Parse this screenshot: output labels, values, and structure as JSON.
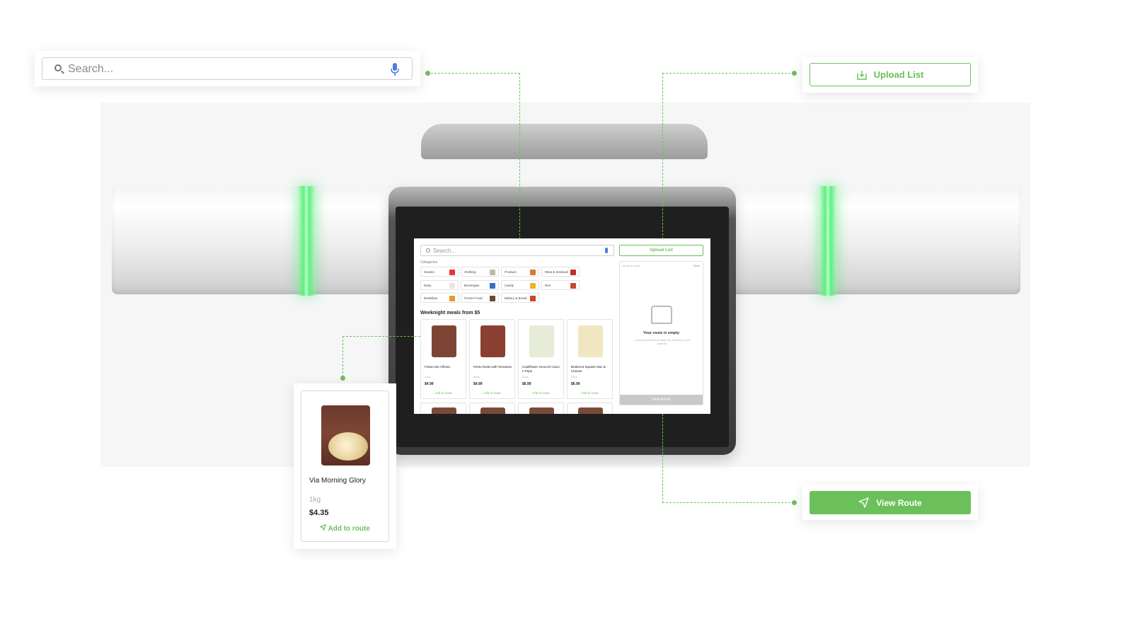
{
  "search": {
    "placeholder": "Search..."
  },
  "upload": {
    "label": "Upload List"
  },
  "view_route": {
    "label": "View Route"
  },
  "product_callout": {
    "name": "Via Morning Glory",
    "weight": "1kg",
    "price": "$4.35",
    "add_label": "Add to route"
  },
  "screen": {
    "search_placeholder": "Search...",
    "upload_label": "Upload List",
    "categories_label": "Categories",
    "categories": [
      {
        "label": "Snacks",
        "color": "#e8343b"
      },
      {
        "label": "Clothing",
        "color": "#c8b8a0"
      },
      {
        "label": "Produce",
        "color": "#d97a2a"
      },
      {
        "label": "Meat & Seafood",
        "color": "#b8322b"
      },
      {
        "label": "Dairy",
        "color": "#e6e6e6"
      },
      {
        "label": "Beverages",
        "color": "#3a6fc0"
      },
      {
        "label": "Candy",
        "color": "#e8b52a"
      },
      {
        "label": "Deli",
        "color": "#c24a3a"
      },
      {
        "label": "Breakfast",
        "color": "#e89a2a"
      },
      {
        "label": "Frozen Food",
        "color": "#6a4a3a"
      },
      {
        "label": "Bakery & Bread",
        "color": "#c9452a"
      }
    ],
    "meals_heading": "Weeknight meals from $5",
    "products": [
      {
        "name": "Fettuccine Alfredo",
        "weight": "22oz",
        "price": "$4.99",
        "add": "Add to route",
        "color": "#7d4634"
      },
      {
        "name": "Pesto Rotini with Tomatoes",
        "weight": "22oz",
        "price": "$4.99",
        "add": "Add to route",
        "color": "#8a4030"
      },
      {
        "name": "Cauliflower Gnocchi Cacio e Pepe",
        "weight": "22oz",
        "price": "$6.99",
        "add": "Add to route",
        "color": "#e7ecd8"
      },
      {
        "name": "Butternut Squash Mac & Cheese",
        "weight": "22oz",
        "price": "$6.99",
        "add": "Add to route",
        "color": "#f1e6c2"
      }
    ],
    "route_panel": {
      "filter_placeholder": "Items in route",
      "clear": "Clear",
      "empty_title": "Your route is empty",
      "empty_sub": "Looks like you haven't added any products to your route yet.",
      "view_route": "View Route"
    }
  },
  "colors": {
    "accent": "#6cc05b",
    "mic": "#4a7fe0"
  }
}
